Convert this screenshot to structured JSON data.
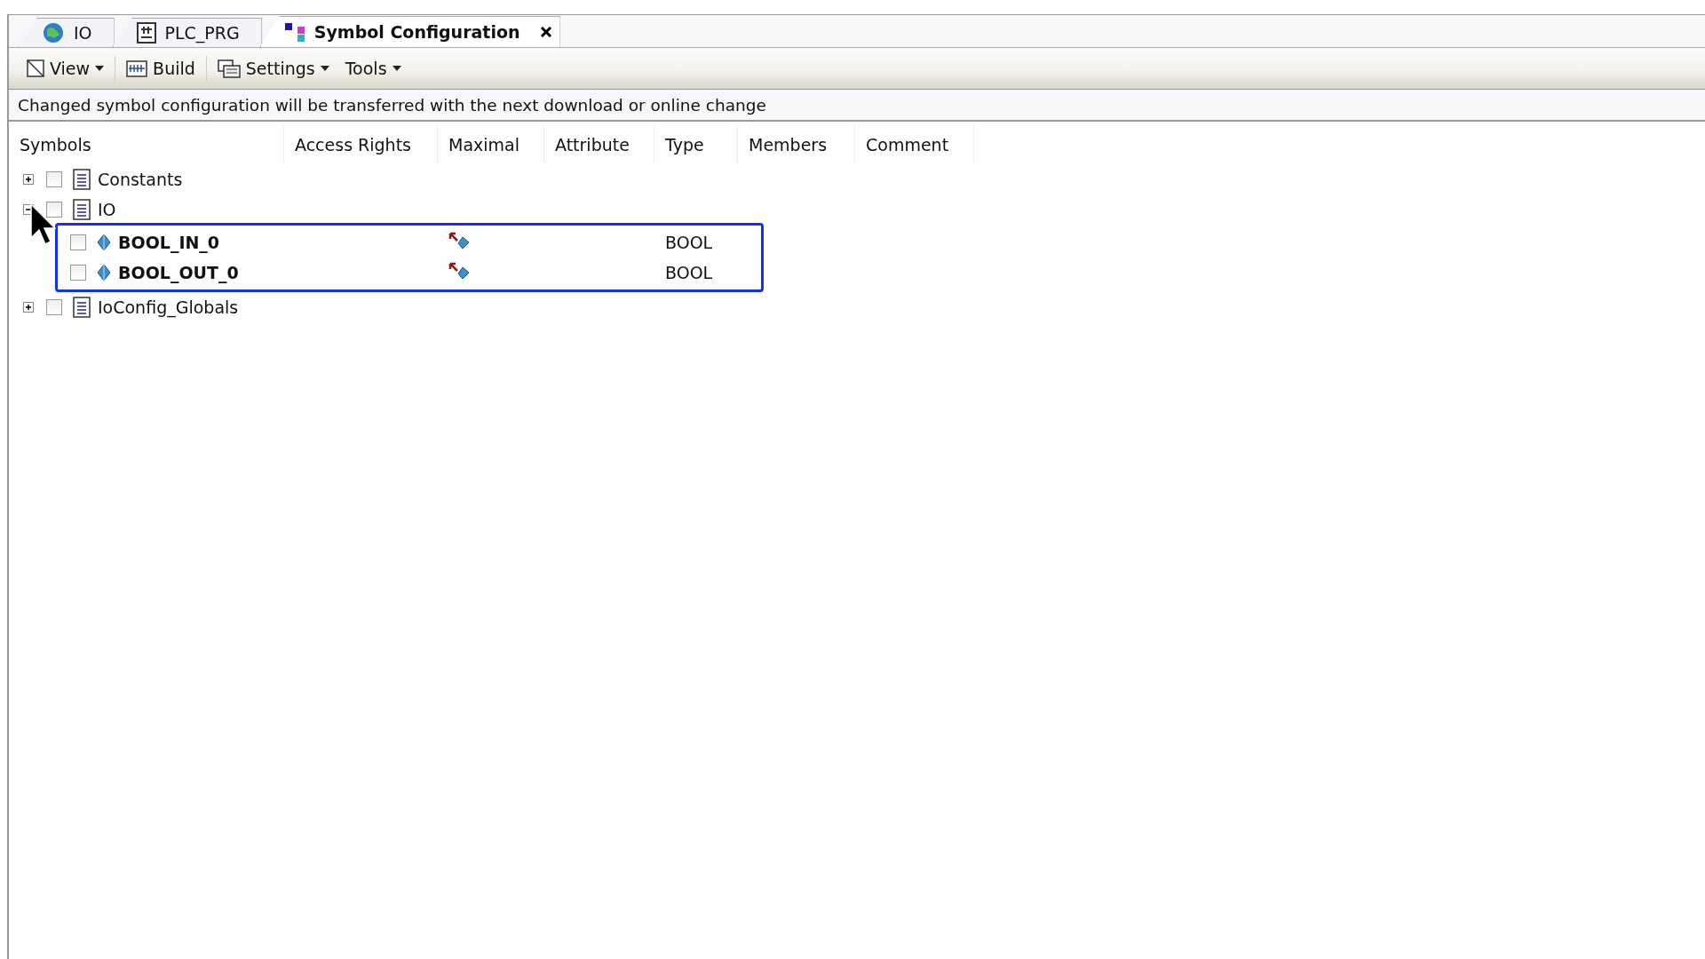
{
  "tabs": [
    {
      "label": "IO",
      "selected": false
    },
    {
      "label": "PLC_PRG",
      "selected": false
    },
    {
      "label": "Symbol Configuration",
      "selected": true
    }
  ],
  "toolbar": [
    {
      "label": "View",
      "dropdown": true
    },
    {
      "label": "Build",
      "dropdown": false
    },
    {
      "label": "Settings",
      "dropdown": true
    },
    {
      "label": "Tools",
      "dropdown": true
    }
  ],
  "message": "Changed symbol configuration will be transferred with the next download or online change",
  "table": {
    "columns": [
      "Symbols",
      "Access Rights",
      "Maximal",
      "Attribute",
      "Type",
      "Members",
      "Comment"
    ],
    "rows": [
      {
        "kind": "folder",
        "name": "Constants",
        "checked": false,
        "expanded": false
      },
      {
        "kind": "folder",
        "name": "IO",
        "checked": false,
        "expanded": true,
        "children": [
          {
            "kind": "variable",
            "name": "BOOL_IN_0",
            "checked": false,
            "type": "BOOL"
          },
          {
            "kind": "variable",
            "name": "BOOL_OUT_0",
            "checked": false,
            "type": "BOOL"
          }
        ]
      },
      {
        "kind": "folder",
        "name": "IoConfig_Globals",
        "checked": false,
        "expanded": false
      }
    ]
  }
}
